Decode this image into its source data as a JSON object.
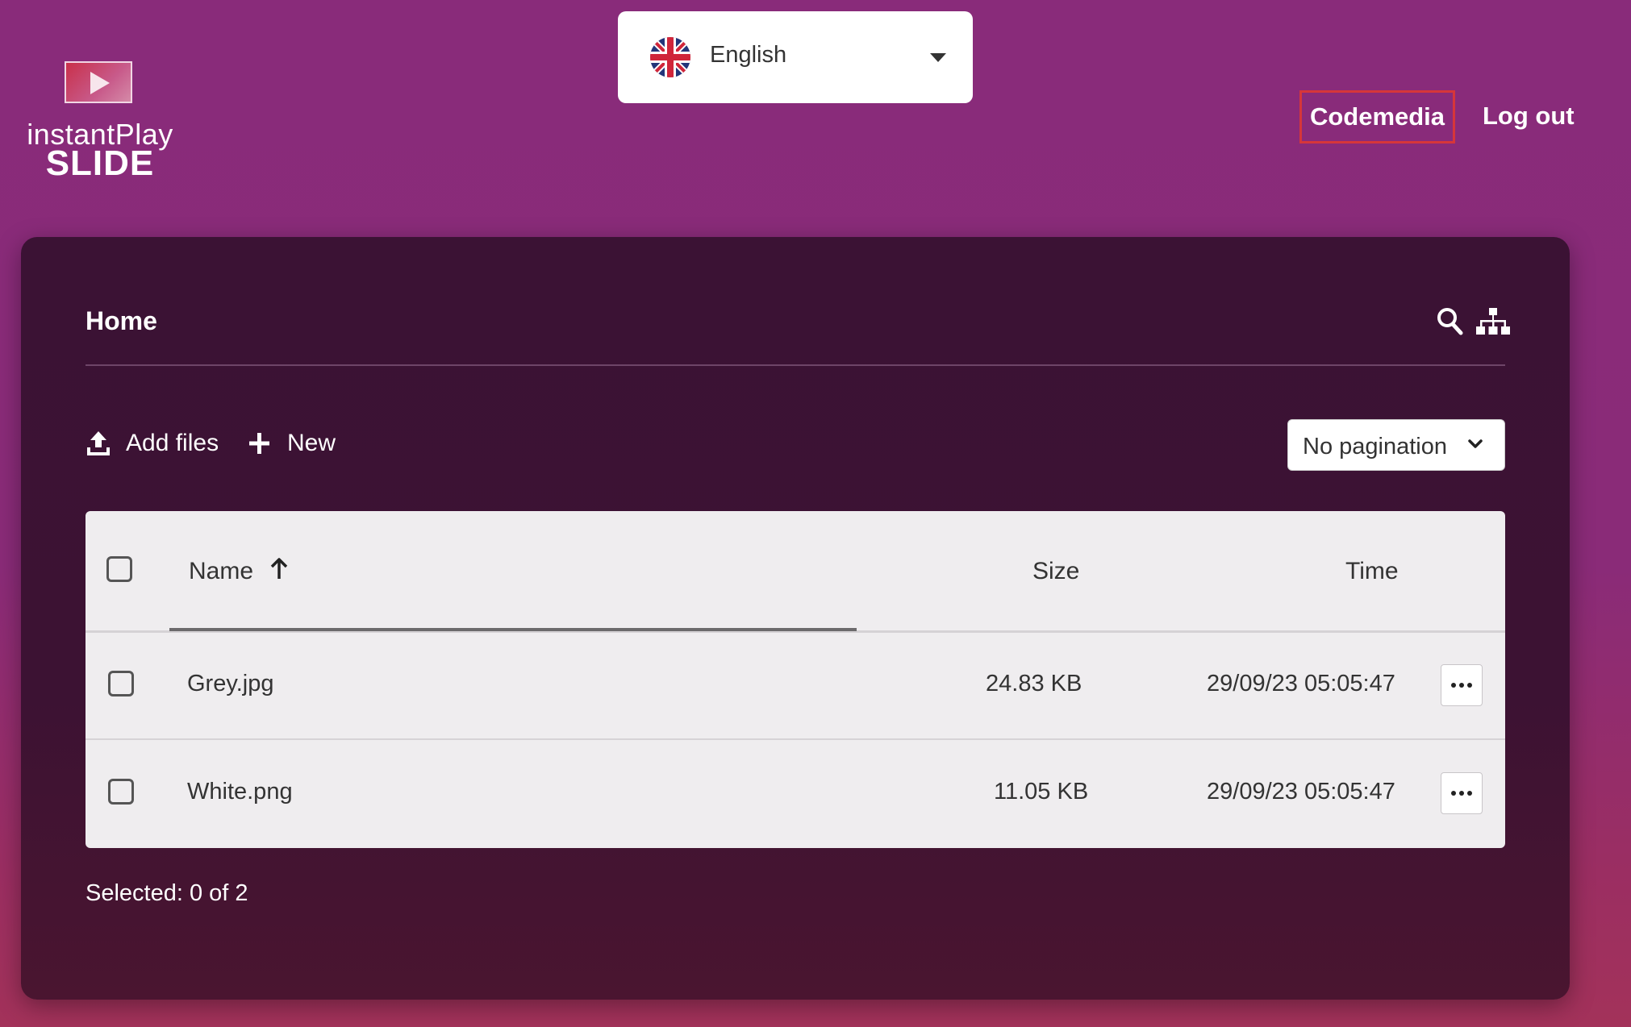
{
  "brand": {
    "line1": "instantPlay",
    "line2": "SLIDE"
  },
  "language": {
    "selected": "English"
  },
  "nav": {
    "user": "Codemedia",
    "logout": "Log out"
  },
  "breadcrumb": {
    "home": "Home"
  },
  "toolbar": {
    "add_files": "Add files",
    "new": "New",
    "pagination": "No pagination"
  },
  "table": {
    "headers": {
      "name": "Name",
      "size": "Size",
      "time": "Time"
    },
    "rows": [
      {
        "name": "Grey.jpg",
        "size": "24.83 KB",
        "time": "29/09/23 05:05:47"
      },
      {
        "name": "White.png",
        "size": "11.05 KB",
        "time": "29/09/23 05:05:47"
      }
    ]
  },
  "status": {
    "selected": "Selected: 0 of 2"
  },
  "colors": {
    "accent_border": "#d6363a",
    "panel": "#3b1234",
    "background": "#892b7a"
  }
}
